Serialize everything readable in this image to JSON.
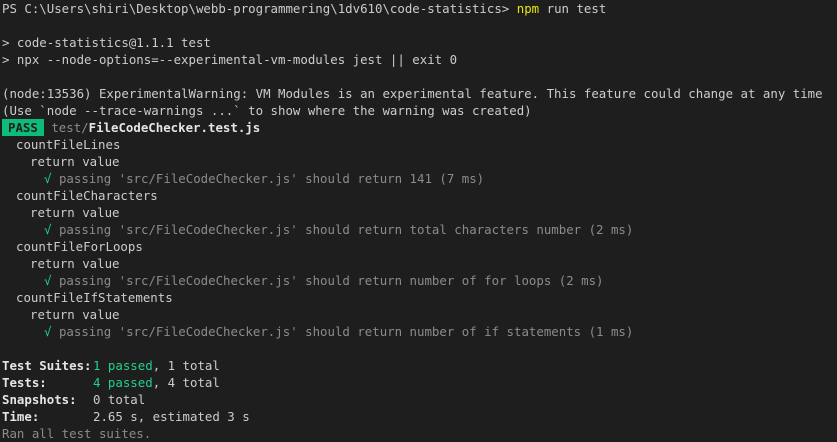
{
  "prompt": {
    "path": "PS C:\\Users\\shiri\\Desktop\\webb-programmering\\1dv610\\code-statistics>",
    "command": "npm",
    "args": "run test"
  },
  "npm_output": {
    "line1": "> code-statistics@1.1.1 test",
    "line2": "> npx --node-options=--experimental-vm-modules jest || exit 0"
  },
  "warning": {
    "line1": "(node:13536) ExperimentalWarning: VM Modules is an experimental feature. This feature could change at any time",
    "line2": "(Use `node --trace-warnings ...` to show where the warning was created)"
  },
  "result": {
    "badge": "PASS",
    "path_prefix": "test/",
    "file": "FileCodeChecker.test.js"
  },
  "suites": [
    {
      "name": "countFileLines",
      "group": "return value",
      "check": "√",
      "test": "passing 'src/FileCodeChecker.js' should return 141 (7 ms)"
    },
    {
      "name": "countFileCharacters",
      "group": "return value",
      "check": "√",
      "test": "passing 'src/FileCodeChecker.js' should return total characters number (2 ms)"
    },
    {
      "name": "countFileForLoops",
      "group": "return value",
      "check": "√",
      "test": "passing 'src/FileCodeChecker.js' should return number of for loops (2 ms)"
    },
    {
      "name": "countFileIfStatements",
      "group": "return value",
      "check": "√",
      "test": "passing 'src/FileCodeChecker.js' should return number of if statements (1 ms)"
    }
  ],
  "summary": {
    "suites_label": "Test Suites:",
    "suites_passed": "1 passed",
    "suites_total": ", 1 total",
    "tests_label": "Tests:",
    "tests_passed": "4 passed",
    "tests_total": ", 4 total",
    "snapshots_label": "Snapshots:",
    "snapshots_value": "0 total",
    "time_label": "Time:",
    "time_value": "2.65 s, estimated 3 s",
    "footer": "Ran all test suites."
  },
  "colors": {
    "background": "#1e1e1e",
    "text": "#cccccc",
    "command": "#e5e510",
    "pass_badge": "#0dbc79",
    "passed": "#23d18b",
    "dim": "#8b8b8b"
  }
}
